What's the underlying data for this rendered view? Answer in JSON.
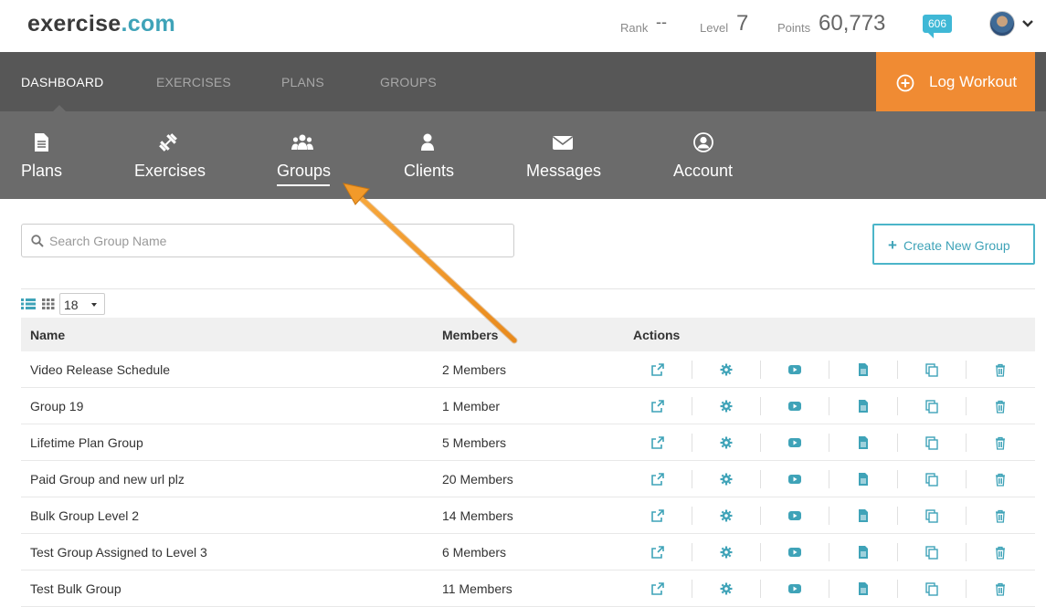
{
  "logo": {
    "part1": "exercise",
    "part2": ".com"
  },
  "stats": {
    "rank_label": "Rank",
    "rank_value": "--",
    "level_label": "Level",
    "level_value": "7",
    "points_label": "Points",
    "points_value": "60,773",
    "notifications": "606"
  },
  "mainnav": {
    "items": [
      "DASHBOARD",
      "EXERCISES",
      "PLANS",
      "GROUPS"
    ],
    "active": "DASHBOARD",
    "log_workout": "Log Workout"
  },
  "subnav": {
    "items": [
      "Plans",
      "Exercises",
      "Groups",
      "Clients",
      "Messages",
      "Account"
    ],
    "active": "Groups"
  },
  "search": {
    "placeholder": "Search Group Name"
  },
  "create_button": "Create New Group",
  "per_page": "18",
  "table": {
    "headers": {
      "name": "Name",
      "members": "Members",
      "actions": "Actions"
    },
    "rows": [
      {
        "name": "Video Release Schedule",
        "members": "2 Members"
      },
      {
        "name": "Group 19",
        "members": "1 Member"
      },
      {
        "name": "Lifetime Plan Group",
        "members": "5 Members"
      },
      {
        "name": "Paid Group and new url plz",
        "members": "20 Members"
      },
      {
        "name": "Bulk Group Level 2",
        "members": "14 Members"
      },
      {
        "name": "Test Group Assigned to Level 3",
        "members": "6 Members"
      },
      {
        "name": "Test Bulk Group",
        "members": "11 Members"
      }
    ],
    "actions": [
      "external-link-icon",
      "gear-icon",
      "video-icon",
      "document-icon",
      "copy-icon",
      "trash-icon"
    ]
  },
  "colors": {
    "accent": "#3fa3b8",
    "orange": "#f08b33",
    "nav_dark": "#575757",
    "nav_mid": "#6b6b6b"
  }
}
